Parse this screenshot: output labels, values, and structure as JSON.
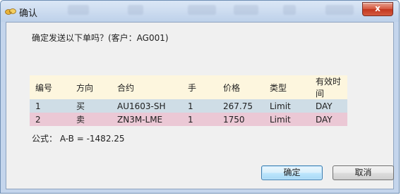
{
  "window": {
    "title": "确认",
    "close_label": "x"
  },
  "dialog": {
    "message": "确定发送以下单吗？(客户：AG001)",
    "table": {
      "headers": [
        "编号",
        "方向",
        "合约",
        "手",
        "价格",
        "类型",
        "有效时间"
      ],
      "rows": [
        [
          "1",
          "买",
          "AU1603-SH",
          "1",
          "267.75",
          "Limit",
          "DAY"
        ],
        [
          "2",
          "卖",
          "ZN3M-LME",
          "1",
          "1750",
          "Limit",
          "DAY"
        ]
      ],
      "row_colors": [
        "#cfdde6",
        "#ebc8d5"
      ],
      "header_color": "#fdf6de"
    },
    "formula": "公式： A-B = -1482.25",
    "buttons": {
      "ok_label": "确定",
      "cancel_label": "取消"
    }
  },
  "icons": {
    "app": "handshake-icon",
    "close": "close-icon"
  }
}
